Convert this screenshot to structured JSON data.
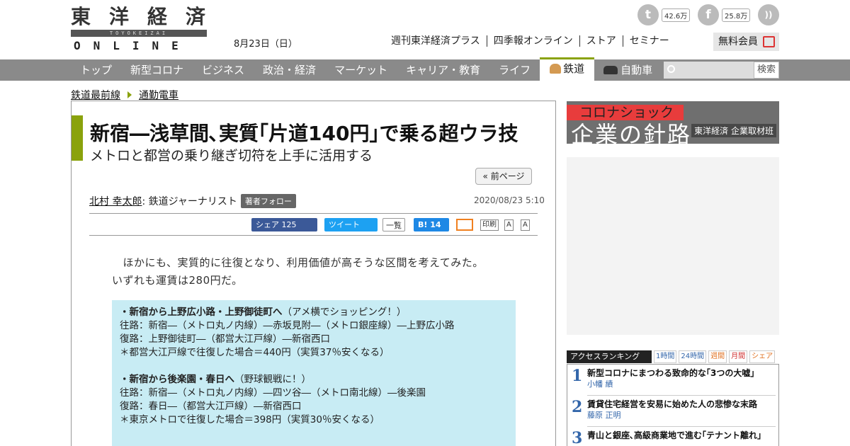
{
  "site": {
    "logo_kanji": [
      "東",
      "洋",
      "経",
      "済"
    ],
    "logo_sub": "TOYOKEIZAI",
    "logo_online": "ONLINE",
    "date": "8月23日（日）",
    "top_links": [
      "週刊東洋経済プラス",
      "四季報オンライン",
      "ストア",
      "セミナー"
    ],
    "member_label": "無料会員",
    "social": [
      {
        "icon": "twitter-icon",
        "glyph": "t",
        "count": "42.6万"
      },
      {
        "icon": "facebook-icon",
        "glyph": "f",
        "count": "25.8万"
      },
      {
        "icon": "rss-icon",
        "glyph": "))",
        "count": ""
      }
    ]
  },
  "nav": {
    "items": [
      "トップ",
      "新型コロナ",
      "ビジネス",
      "政治・経済",
      "マーケット",
      "キャリア・教育",
      "ライフ"
    ],
    "active": "鉄道",
    "after": "自動車",
    "search_label": "検索"
  },
  "breadcrumb": [
    "鉄道最前線",
    "通勤電車"
  ],
  "article": {
    "title": "新宿―浅草間､実質｢片道140円｣で乗る超ウラ技",
    "subtitle": "メトロと都営の乗り継ぎ切符を上手に活用する",
    "prev_page": "« 前ページ",
    "author_name": "北村 幸太郎",
    "author_role": " : 鉄道ジャーナリスト",
    "follow_label": "著者フォロー",
    "published": "2020/08/23 5:10",
    "share": {
      "facebook": "シェア  125",
      "tweet": "ツイート",
      "list": "一覧",
      "hatena": "B! 14",
      "print": "印刷",
      "font_small": "A",
      "font_large": "A"
    },
    "body_lines": [
      "　ほかにも、実質的に往復となり、利用価値が高そうな区間を考えてみた。",
      "いずれも運賃は280円だ。"
    ],
    "routes": [
      {
        "title": "・新宿から上野広小路・上野御徒町へ",
        "note": "（アメ横でショッピング！）",
        "lines": [
          "往路：新宿―（メトロ丸ノ内線）―赤坂見附―（メトロ銀座線）―上野広小路",
          "復路：上野御徒町―（都営大江戸線）―新宿西口",
          "＊都営大江戸線で往復した場合＝440円（実質37％安くなる）"
        ]
      },
      {
        "title": "・新宿から後楽園・春日へ",
        "note": "（野球観戦に！）",
        "lines": [
          "往路：新宿―（メトロ丸ノ内線）―四ツ谷―（メトロ南北線）―後楽園",
          "復路：春日―（都営大江戸線）―新宿西口",
          "＊東京メトロで往復した場合＝398円（実質30％安くなる）"
        ]
      }
    ]
  },
  "sidebar": {
    "banner_red": "コロナショック",
    "banner_big": "企業の針路",
    "banner_credit": "東洋経済 企業取材班",
    "ranking_title": "アクセスランキング",
    "ranking_tabs": [
      "1時間",
      "24時間",
      "週間",
      "月間",
      "シェア"
    ],
    "ranking_items": [
      {
        "rank": "1",
        "headline": "新型コロナにまつわる致命的な｢3つの大嘘｣",
        "author": "小幡 績"
      },
      {
        "rank": "2",
        "headline": "賃貸住宅経営を安易に始めた人の悲惨な末路",
        "author": "藤原 正明"
      },
      {
        "rank": "3",
        "headline": "青山と銀座､高級商業地で進む｢テナント離れ｣",
        "author": ""
      }
    ]
  },
  "colors": {
    "accent_green": "#8aa20c",
    "nav_gray": "#8a8a8a",
    "route_box": "#c8ecf4",
    "facebook": "#3b5998",
    "twitter": "#1da1f2"
  }
}
